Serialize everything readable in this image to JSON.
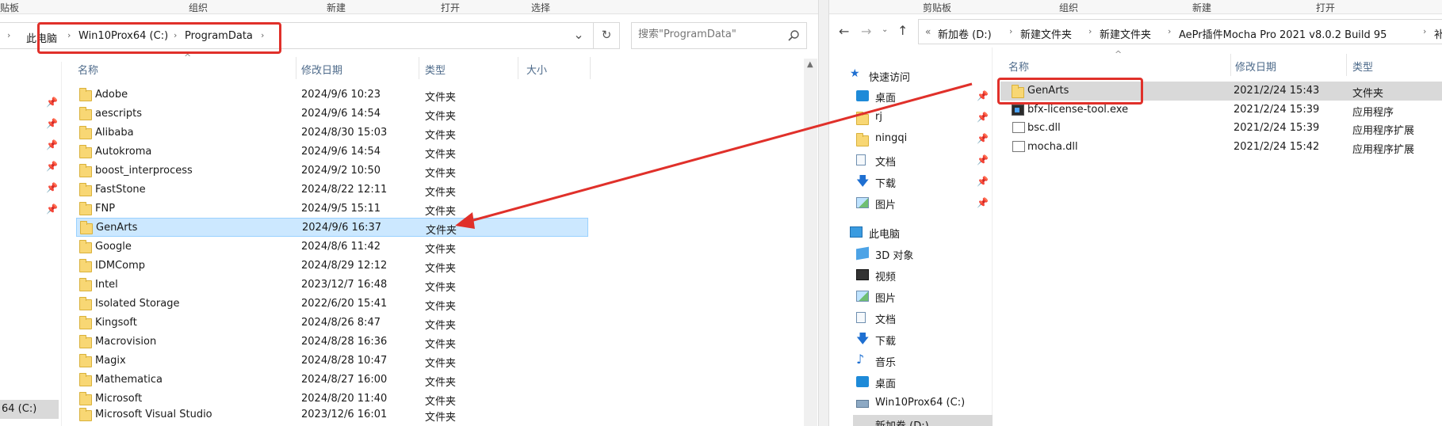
{
  "left": {
    "ribbon": [
      "贴板",
      "组织",
      "新建",
      "打开",
      "选择"
    ],
    "breadcrumb": [
      "此电脑",
      "Win10Prox64 (C:)",
      "ProgramData"
    ],
    "dropdown_glyph": "⌄",
    "refresh_glyph": "↻",
    "search": {
      "placeholder": "搜索\"ProgramData\""
    },
    "columns": {
      "name": "名称",
      "date": "修改日期",
      "type": "类型",
      "size": "大小"
    },
    "rows": [
      {
        "name": "Adobe",
        "date": "2024/9/6 10:23",
        "type": "文件夹"
      },
      {
        "name": "aescripts",
        "date": "2024/9/6 14:54",
        "type": "文件夹"
      },
      {
        "name": "Alibaba",
        "date": "2024/8/30 15:03",
        "type": "文件夹"
      },
      {
        "name": "Autokroma",
        "date": "2024/9/6 14:54",
        "type": "文件夹"
      },
      {
        "name": "boost_interprocess",
        "date": "2024/9/2 10:50",
        "type": "文件夹"
      },
      {
        "name": "FastStone",
        "date": "2024/8/22 12:11",
        "type": "文件夹"
      },
      {
        "name": "FNP",
        "date": "2024/9/5 15:11",
        "type": "文件夹"
      },
      {
        "name": "GenArts",
        "date": "2024/9/6 16:37",
        "type": "文件夹"
      },
      {
        "name": "Google",
        "date": "2024/8/6 11:42",
        "type": "文件夹"
      },
      {
        "name": "IDMComp",
        "date": "2024/8/29 12:12",
        "type": "文件夹"
      },
      {
        "name": "Intel",
        "date": "2023/12/7 16:48",
        "type": "文件夹"
      },
      {
        "name": "Isolated Storage",
        "date": "2022/6/20 15:41",
        "type": "文件夹"
      },
      {
        "name": "Kingsoft",
        "date": "2024/8/26 8:47",
        "type": "文件夹"
      },
      {
        "name": "Macrovision",
        "date": "2024/8/28 16:36",
        "type": "文件夹"
      },
      {
        "name": "Magix",
        "date": "2024/8/28 10:47",
        "type": "文件夹"
      },
      {
        "name": "Mathematica",
        "date": "2024/8/27 16:00",
        "type": "文件夹"
      },
      {
        "name": "Microsoft",
        "date": "2024/8/20 11:40",
        "type": "文件夹"
      },
      {
        "name": "Microsoft Visual Studio",
        "date": "2023/12/6 16:01",
        "type": "文件夹"
      }
    ],
    "selected_row": "GenArts",
    "status_drive": "64 (C:)"
  },
  "right": {
    "ribbon": [
      "剪贴板",
      "组织",
      "新建",
      "打开"
    ],
    "breadcrumb_overflow": "«",
    "breadcrumb": [
      "新加卷 (D:)",
      "新建文件夹",
      "新建文件夹",
      "AePr插件Mocha Pro 2021 v8.0.2 Build 95",
      "补丁"
    ],
    "columns": {
      "name": "名称",
      "date": "修改日期",
      "type": "类型"
    },
    "nav": {
      "quick_access": "快速访问",
      "quick_items": [
        "桌面",
        "rj",
        "ningqi",
        "文档",
        "下载",
        "图片"
      ],
      "this_pc": "此电脑",
      "pc_items": [
        "3D 对象",
        "视频",
        "图片",
        "文档",
        "下载",
        "音乐",
        "桌面",
        "Win10Prox64 (C:)",
        "新加卷 (D:)"
      ]
    },
    "files": [
      {
        "name": "GenArts",
        "date": "2021/2/24 15:43",
        "type": "文件夹",
        "icon": "folder-icon"
      },
      {
        "name": "bfx-license-tool.exe",
        "date": "2021/2/24 15:39",
        "type": "应用程序",
        "icon": "exe-icon"
      },
      {
        "name": "bsc.dll",
        "date": "2021/2/24 15:39",
        "type": "应用程序扩展",
        "icon": "dll-icon"
      },
      {
        "name": "mocha.dll",
        "date": "2021/2/24 15:42",
        "type": "应用程序扩展",
        "icon": "dll-icon"
      }
    ]
  },
  "colors": {
    "annotation_red": "#e0302a",
    "selection_bg": "#cce8ff",
    "selection_border": "#99d1ff",
    "header_text": "#4d6a8a"
  }
}
